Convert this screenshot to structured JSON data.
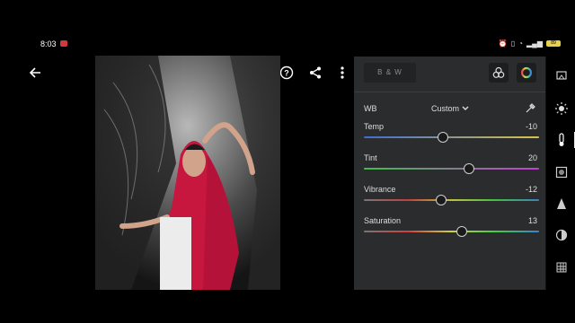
{
  "status": {
    "time": "8:03",
    "battery": "89"
  },
  "panel": {
    "bw_label": "B & W",
    "wb_label": "WB",
    "wb_value": "Custom",
    "sliders": [
      {
        "name": "Temp",
        "value": "-10",
        "pos": 0.45
      },
      {
        "name": "Tint",
        "value": "20",
        "pos": 0.6
      },
      {
        "name": "Vibrance",
        "value": "-12",
        "pos": 0.44
      },
      {
        "name": "Saturation",
        "value": "13",
        "pos": 0.56
      }
    ]
  },
  "icons": {
    "back": "back-arrow-icon",
    "undo": "undo-icon",
    "help": "help-icon",
    "share": "share-icon",
    "more": "more-vertical-icon"
  },
  "colors": {
    "panel_bg": "#2b2c2e",
    "temp_track": "linear-gradient(90deg,#3f6bd6,#d9c24a)",
    "tint_track": "linear-gradient(90deg,#3fbf4a,#c43fd0)",
    "vib_track": "linear-gradient(90deg,#777,#c04040,#c0c040,#40c040,#4080c0)",
    "sat_track": "linear-gradient(90deg,#777,#d04040,#d0d040,#40d040,#4080d0)"
  }
}
